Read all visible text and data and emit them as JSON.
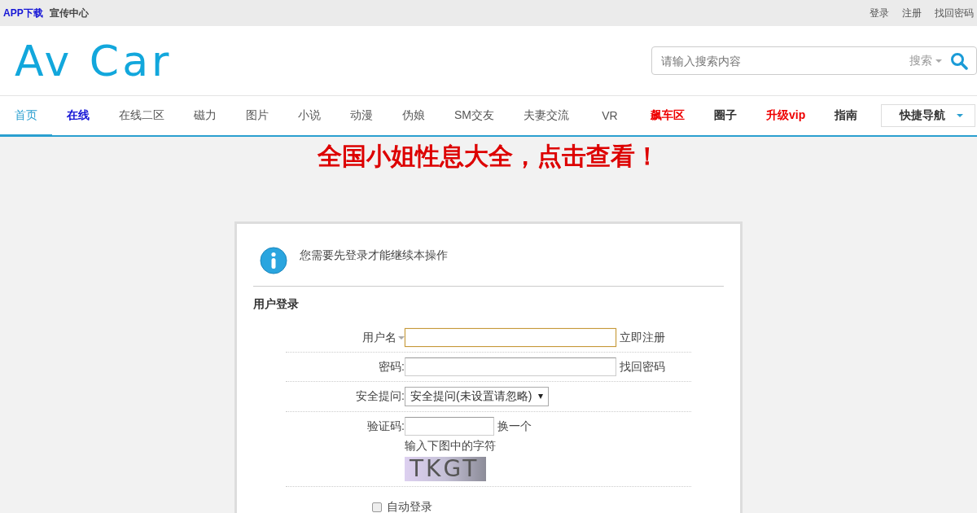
{
  "top_bar": {
    "left_links": [
      {
        "label": "APP下载",
        "kind": "highlight"
      },
      {
        "label": "宣传中心",
        "kind": "plain"
      }
    ],
    "right_links": [
      "登录",
      "注册",
      "找回密码"
    ]
  },
  "header": {
    "logo": "Av Car",
    "search": {
      "placeholder": "请输入搜索内容",
      "type_label": "搜索"
    }
  },
  "nav": {
    "items": [
      {
        "label": "首页",
        "kind": "plain",
        "selected": true
      },
      {
        "label": "在线",
        "kind": "blue",
        "selected": false
      },
      {
        "label": "在线二区",
        "kind": "plain",
        "selected": false
      },
      {
        "label": "磁力",
        "kind": "plain",
        "selected": false
      },
      {
        "label": "图片",
        "kind": "plain",
        "selected": false
      },
      {
        "label": "小说",
        "kind": "plain",
        "selected": false
      },
      {
        "label": "动漫",
        "kind": "plain",
        "selected": false
      },
      {
        "label": "伪娘",
        "kind": "plain",
        "selected": false
      },
      {
        "label": "SM交友",
        "kind": "plain",
        "selected": false
      },
      {
        "label": "夫妻交流",
        "kind": "plain",
        "selected": false
      },
      {
        "label": "VR",
        "kind": "plain",
        "selected": false
      },
      {
        "label": "飙车区",
        "kind": "red",
        "selected": false
      },
      {
        "label": "圈子",
        "kind": "dark",
        "selected": false
      },
      {
        "label": "升级vip",
        "kind": "red",
        "selected": false
      },
      {
        "label": "指南",
        "kind": "dark",
        "selected": false
      }
    ],
    "quick_nav": "快捷导航"
  },
  "banner": "全国小姐性息大全，点击查看！",
  "login": {
    "notice": "您需要先登录才能继续本操作",
    "title": "用户登录",
    "rows": [
      {
        "kind": "text",
        "label": "用户名",
        "value": "",
        "focused": true,
        "side_link": "立即注册"
      },
      {
        "kind": "password",
        "label": "密码:",
        "focused": false,
        "side_link": "找回密码"
      },
      {
        "kind": "select",
        "label": "安全提问:",
        "value": "安全提问(未设置请忽略)"
      },
      {
        "kind": "captcha",
        "label": "验证码:",
        "side_link": "换一个",
        "hint": "输入下图中的字符",
        "captcha": "TKGT"
      }
    ],
    "auto_login": {
      "label": "自动登录",
      "checked": false
    }
  }
}
